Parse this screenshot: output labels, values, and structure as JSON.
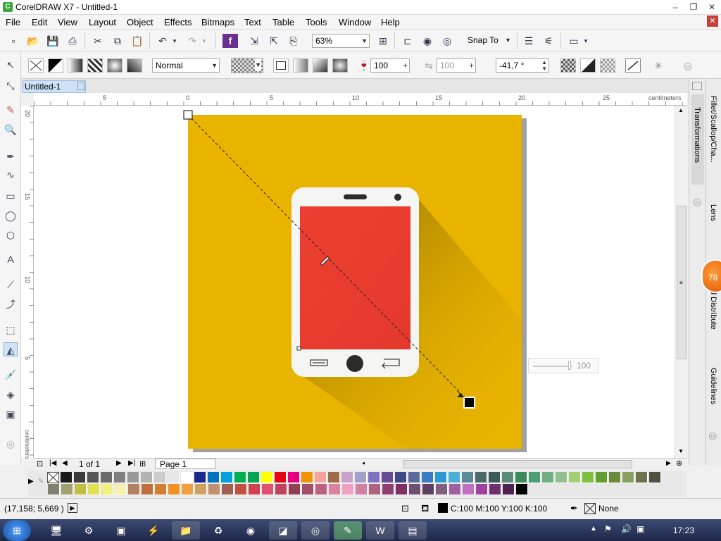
{
  "window": {
    "title": "CorelDRAW X7 - Untitled-1",
    "app_icon": "coreldraw-icon",
    "min": "–",
    "max": "❐",
    "close": "✕"
  },
  "menu": {
    "file": "File",
    "edit": "Edit",
    "view": "View",
    "layout": "Layout",
    "object": "Object",
    "effects": "Effects",
    "bitmaps": "Bitmaps",
    "text": "Text",
    "table": "Table",
    "tools": "Tools",
    "window": "Window",
    "help": "Help"
  },
  "toolbar": {
    "zoom": "63%",
    "snap_to": "Snap To"
  },
  "property_bar": {
    "mode": "Normal",
    "opacity_value": "100",
    "percent1": "%",
    "feather_value": "100",
    "percent2": "%",
    "angle_value": "-41,7 °"
  },
  "document": {
    "tab": "Untitled-1"
  },
  "ruler": {
    "units": "centimeters",
    "h_ticks": [
      "5",
      "0",
      "5",
      "10",
      "15",
      "20",
      "25"
    ],
    "v_ticks": [
      "20",
      "15",
      "10",
      "5"
    ]
  },
  "canvas": {
    "slider_value": "100"
  },
  "dockers": {
    "transformations": "Transformations",
    "fillet": "Fillet/Scallop/Cha...",
    "lens": "Lens",
    "align": "d Distribute",
    "guidelines": "Guidelines",
    "badge": "78"
  },
  "page_nav": {
    "count": "1 of 1",
    "page_tab": "Page 1"
  },
  "status": {
    "coords": "(17,158; 5,669 )",
    "fill_info": "C:100 M:100 Y:100 K:100",
    "outline": "None"
  },
  "taskbar": {
    "time": "17:23"
  },
  "colors": {
    "page_bg": "#e9b400",
    "phone_screen": "#e83a2f",
    "accent": "#3aa541"
  }
}
